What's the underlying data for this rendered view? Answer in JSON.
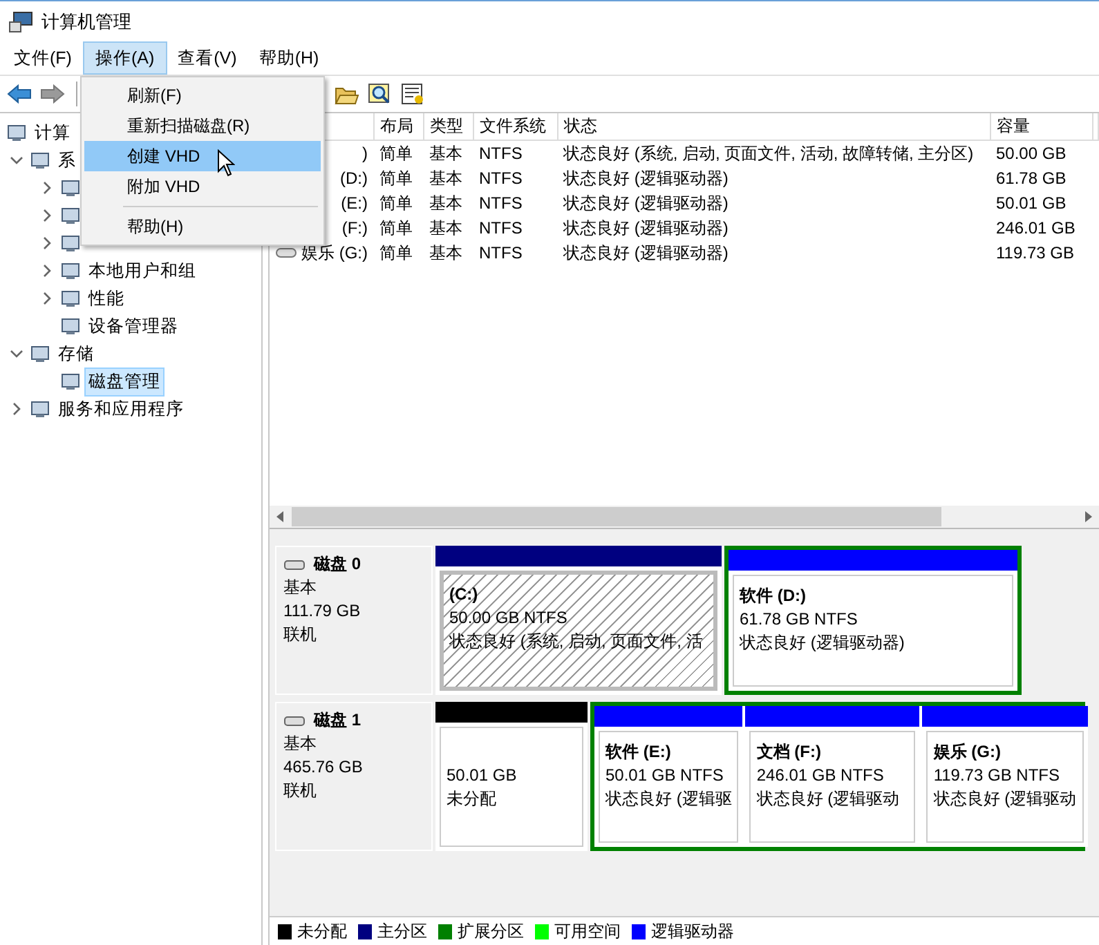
{
  "window": {
    "title": "计算机管理"
  },
  "menu_bar": [
    {
      "label": "文件(F)",
      "selected": false
    },
    {
      "label": "操作(A)",
      "selected": true
    },
    {
      "label": "查看(V)",
      "selected": false
    },
    {
      "label": "帮助(H)",
      "selected": false
    }
  ],
  "dropdown_menu": [
    {
      "label": "刷新(F)",
      "selected": false
    },
    {
      "label": "重新扫描磁盘(R)",
      "selected": false
    },
    {
      "label": "创建 VHD",
      "selected": true
    },
    {
      "label": "附加 VHD",
      "selected": false
    },
    {
      "kind": "separator"
    },
    {
      "label": "帮助(H)",
      "selected": false
    }
  ],
  "tree": [
    {
      "label": "计算",
      "selected": false,
      "children": [
        {
          "label": "系",
          "expanded": true,
          "selected": false,
          "children": [
            {
              "expanded": false,
              "selected": false
            },
            {
              "expanded": false,
              "selected": false
            },
            {
              "expanded": false,
              "selected": false
            },
            {
              "label": "本地用户和组",
              "expanded": false,
              "selected": false
            },
            {
              "label": "性能",
              "expanded": false,
              "selected": false
            },
            {
              "label": "设备管理器",
              "selected": false
            }
          ]
        },
        {
          "label": "存储",
          "expanded": true,
          "selected": false,
          "children": [
            {
              "label": "磁盘管理",
              "selected": true
            }
          ]
        },
        {
          "label": "服务和应用程序",
          "expanded": false,
          "selected": false
        }
      ]
    }
  ],
  "table": {
    "columns": [
      "布局",
      "类型",
      "文件系统",
      "状态",
      "容量"
    ],
    "rows": [
      {
        "name": ")",
        "cells": [
          "简单",
          "基本",
          "NTFS",
          "状态良好 (系统, 启动, 页面文件, 活动, 故障转储, 主分区)",
          "50.00 GB"
        ]
      },
      {
        "name": "(D:)",
        "cells": [
          "简单",
          "基本",
          "NTFS",
          "状态良好 (逻辑驱动器)",
          "61.78 GB"
        ]
      },
      {
        "name": "(E:)",
        "cells": [
          "简单",
          "基本",
          "NTFS",
          "状态良好 (逻辑驱动器)",
          "50.01 GB"
        ]
      },
      {
        "name": "(F:)",
        "cells": [
          "简单",
          "基本",
          "NTFS",
          "状态良好 (逻辑驱动器)",
          "246.01 GB"
        ]
      },
      {
        "name": "娱乐 (G:)",
        "cells": [
          "简单",
          "基本",
          "NTFS",
          "状态良好 (逻辑驱动器)",
          "119.73 GB"
        ]
      }
    ]
  },
  "disks": [
    {
      "name": "磁盘 0",
      "type": "基本",
      "size": "111.79 GB",
      "status": "联机",
      "partitions": [
        {
          "kind": "primary",
          "selected": true,
          "name": "(C:)",
          "size": "50.00 GB NTFS",
          "status": "状态良好 (系统, 启动, 页面文件, 活"
        },
        {
          "kind": "extended",
          "children": [
            {
              "kind": "logical",
              "selected": false,
              "name": "软件  (D:)",
              "size": "61.78 GB NTFS",
              "status": "状态良好 (逻辑驱动器)"
            }
          ]
        }
      ]
    },
    {
      "name": "磁盘 1",
      "type": "基本",
      "size": "465.76 GB",
      "status": "联机",
      "partitions": [
        {
          "kind": "unallocated",
          "selected": false,
          "size": "50.01 GB",
          "status": "未分配"
        },
        {
          "kind": "extended",
          "children": [
            {
              "kind": "logical",
              "selected": false,
              "name": "软件  (E:)",
              "size": "50.01 GB NTFS",
              "status": "状态良好 (逻辑驱"
            },
            {
              "kind": "logical",
              "selected": false,
              "name": "文档  (F:)",
              "size": "246.01 GB NTFS",
              "status": "状态良好 (逻辑驱动"
            },
            {
              "kind": "logical",
              "selected": false,
              "name": "娱乐  (G:)",
              "size": "119.73 GB NTFS",
              "status": "状态良好 (逻辑驱动"
            }
          ]
        }
      ]
    }
  ],
  "legend": [
    {
      "label": "未分配",
      "color": "#000000"
    },
    {
      "label": "主分区",
      "color": "#000080"
    },
    {
      "label": "扩展分区",
      "color": "#008000"
    },
    {
      "label": "可用空间",
      "color": "#00ff00"
    },
    {
      "label": "逻辑驱动器",
      "color": "#0000ff"
    }
  ]
}
